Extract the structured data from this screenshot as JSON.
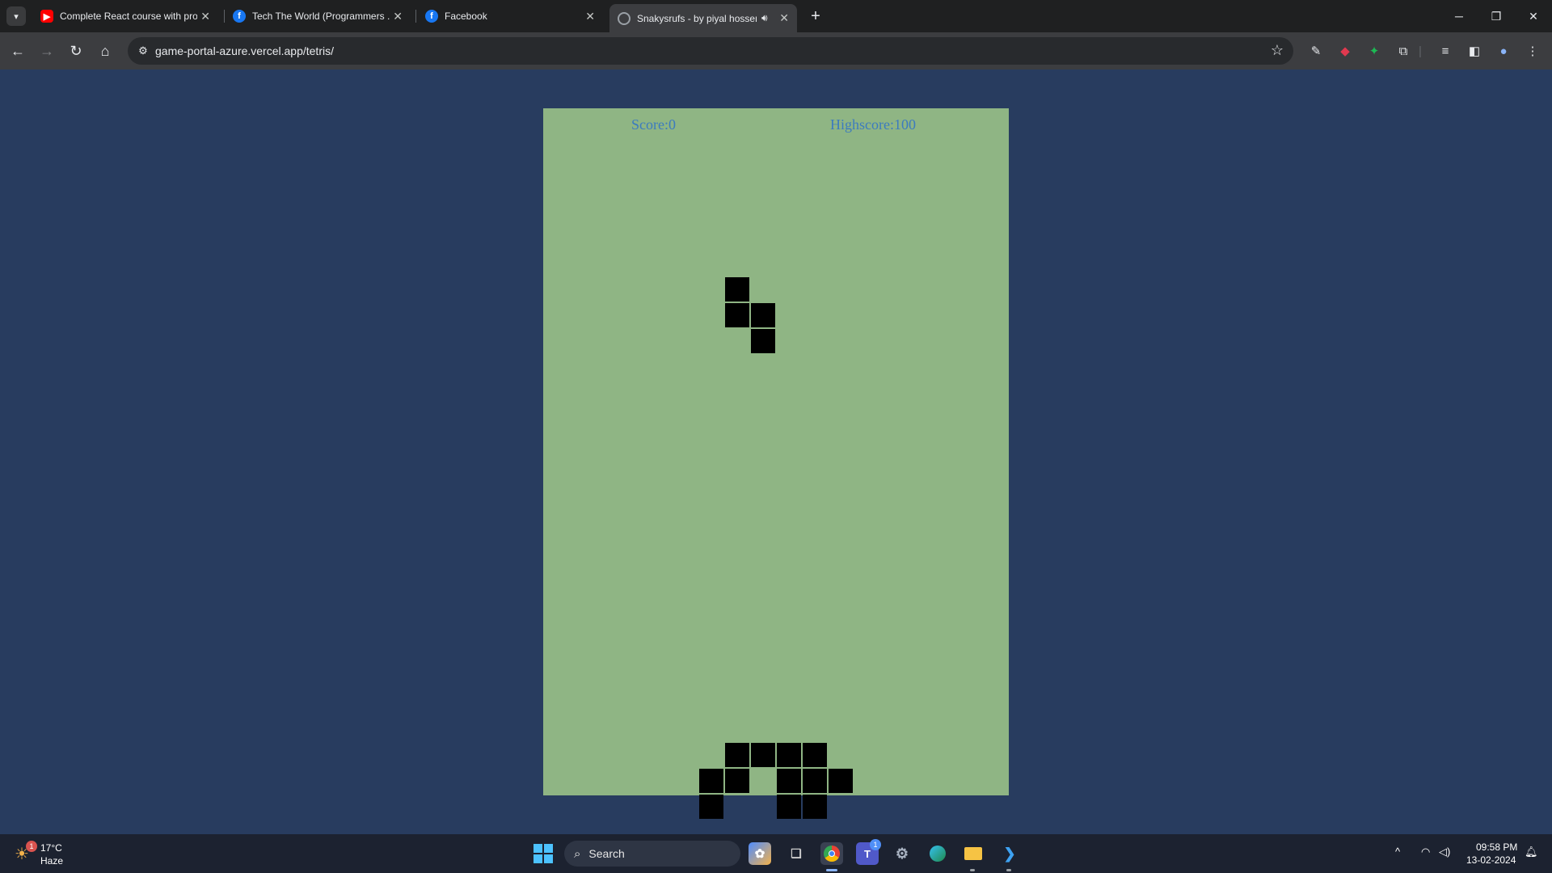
{
  "browser": {
    "tabs": [
      {
        "title": "Complete React course with pro",
        "favicon": "youtube-icon",
        "color": "#ff0000"
      },
      {
        "title": "Tech The World (Programmers ...",
        "favicon": "facebook-icon",
        "color": "#1877f2"
      },
      {
        "title": "Facebook",
        "favicon": "facebook-icon",
        "color": "#1877f2"
      },
      {
        "title": "Snakysrufs - by piyal hossen",
        "favicon": "globe-icon",
        "color": "#9aa0a6",
        "active": true,
        "audio": true
      }
    ],
    "url": "game-portal-azure.vercel.app/tetris/"
  },
  "game": {
    "score_label": "Score:0",
    "highscore_label": "Highscore:100",
    "score": 0,
    "highscore": 100,
    "board_color": "#8fb584",
    "block_color": "#000000",
    "falling_piece": [
      [
        7,
        6
      ],
      [
        7,
        7
      ],
      [
        8,
        7
      ],
      [
        8,
        8
      ]
    ],
    "stack": [
      [
        7,
        24
      ],
      [
        8,
        24
      ],
      [
        9,
        24
      ],
      [
        10,
        24
      ],
      [
        6,
        25
      ],
      [
        7,
        25
      ],
      [
        9,
        25
      ],
      [
        10,
        25
      ],
      [
        11,
        25
      ],
      [
        6,
        26
      ],
      [
        9,
        26
      ],
      [
        10,
        26
      ]
    ]
  },
  "taskbar": {
    "weather_temp": "17°C",
    "weather_condition": "Haze",
    "weather_badge": "1",
    "search_placeholder": "Search",
    "teams_badge": "1",
    "time": "09:58 PM",
    "date": "13-02-2024"
  }
}
